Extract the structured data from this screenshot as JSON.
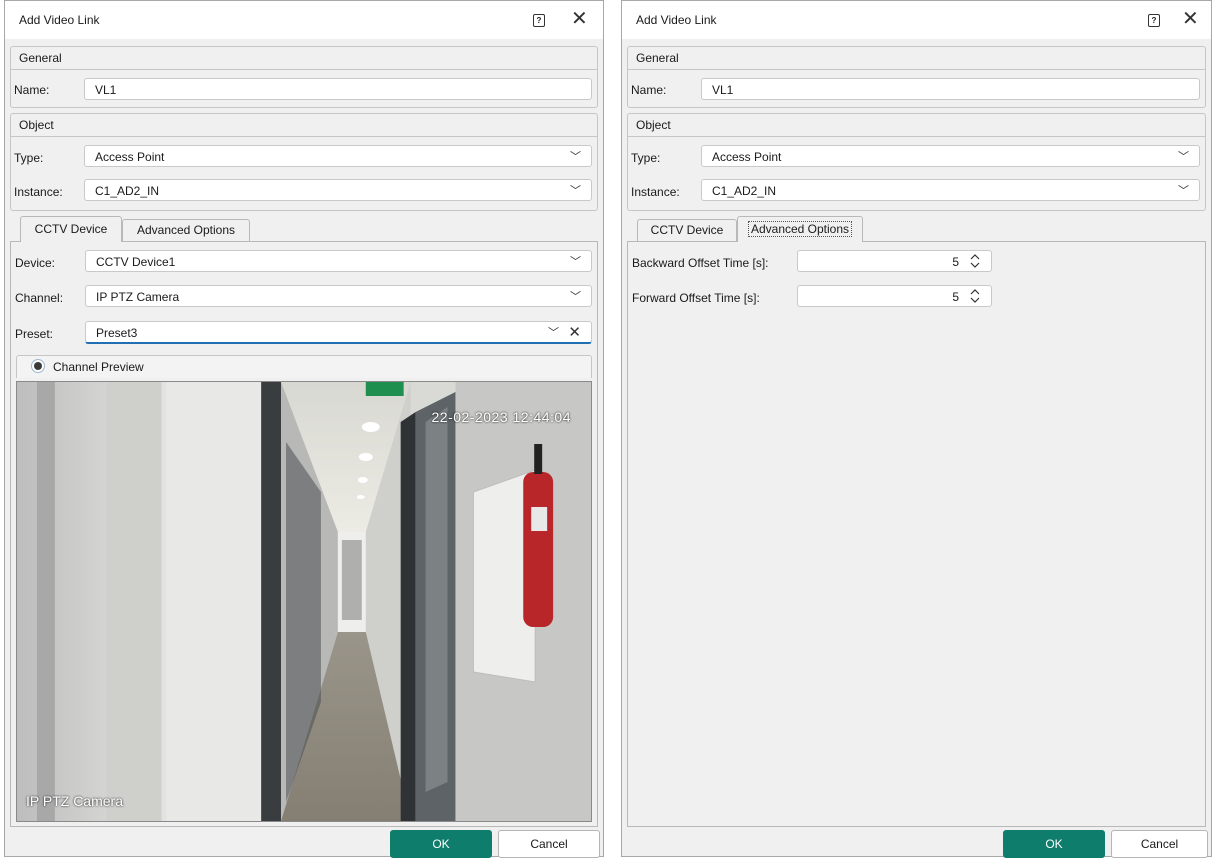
{
  "left_dialog": {
    "title": "Add Video Link",
    "general": {
      "title": "General",
      "name_label": "Name:",
      "name_value": "VL1"
    },
    "object": {
      "title": "Object",
      "type_label": "Type:",
      "type_value": "Access Point",
      "instance_label": "Instance:",
      "instance_value": "C1_AD2_IN"
    },
    "tabs": [
      {
        "label": "CCTV Device",
        "selected": true
      },
      {
        "label": "Advanced Options",
        "selected": false
      }
    ],
    "cctv": {
      "device_label": "Device:",
      "device_value": "CCTV Device1",
      "channel_label": "Channel:",
      "channel_value": "IP PTZ Camera",
      "preset_label": "Preset:",
      "preset_value": "Preset3"
    },
    "preview": {
      "title": "Channel Preview",
      "osd_timestamp": "22-02-2023 12:44:04",
      "osd_camera": "IP PTZ Camera",
      "exit_sign": "EXIT"
    },
    "buttons": {
      "ok": "OK",
      "cancel": "Cancel"
    }
  },
  "right_dialog": {
    "title": "Add Video Link",
    "general": {
      "title": "General",
      "name_label": "Name:",
      "name_value": "VL1"
    },
    "object": {
      "title": "Object",
      "type_label": "Type:",
      "type_value": "Access Point",
      "instance_label": "Instance:",
      "instance_value": "C1_AD2_IN"
    },
    "tabs": [
      {
        "label": "CCTV Device",
        "selected": false
      },
      {
        "label": "Advanced Options",
        "selected": true
      }
    ],
    "advanced": {
      "backward_label": "Backward Offset Time [s]:",
      "backward_value": "5",
      "forward_label": "Forward Offset Time [s]:",
      "forward_value": "5"
    },
    "buttons": {
      "ok": "OK",
      "cancel": "Cancel"
    }
  },
  "colors": {
    "accent": "#0f7d6c",
    "focus_underline": "#1f6fb2",
    "dialog_bg": "#f0f0f0"
  },
  "icons": [
    "help-icon",
    "close-icon",
    "chevron-down-icon",
    "clear-icon",
    "eye-icon",
    "spinner-icon"
  ]
}
